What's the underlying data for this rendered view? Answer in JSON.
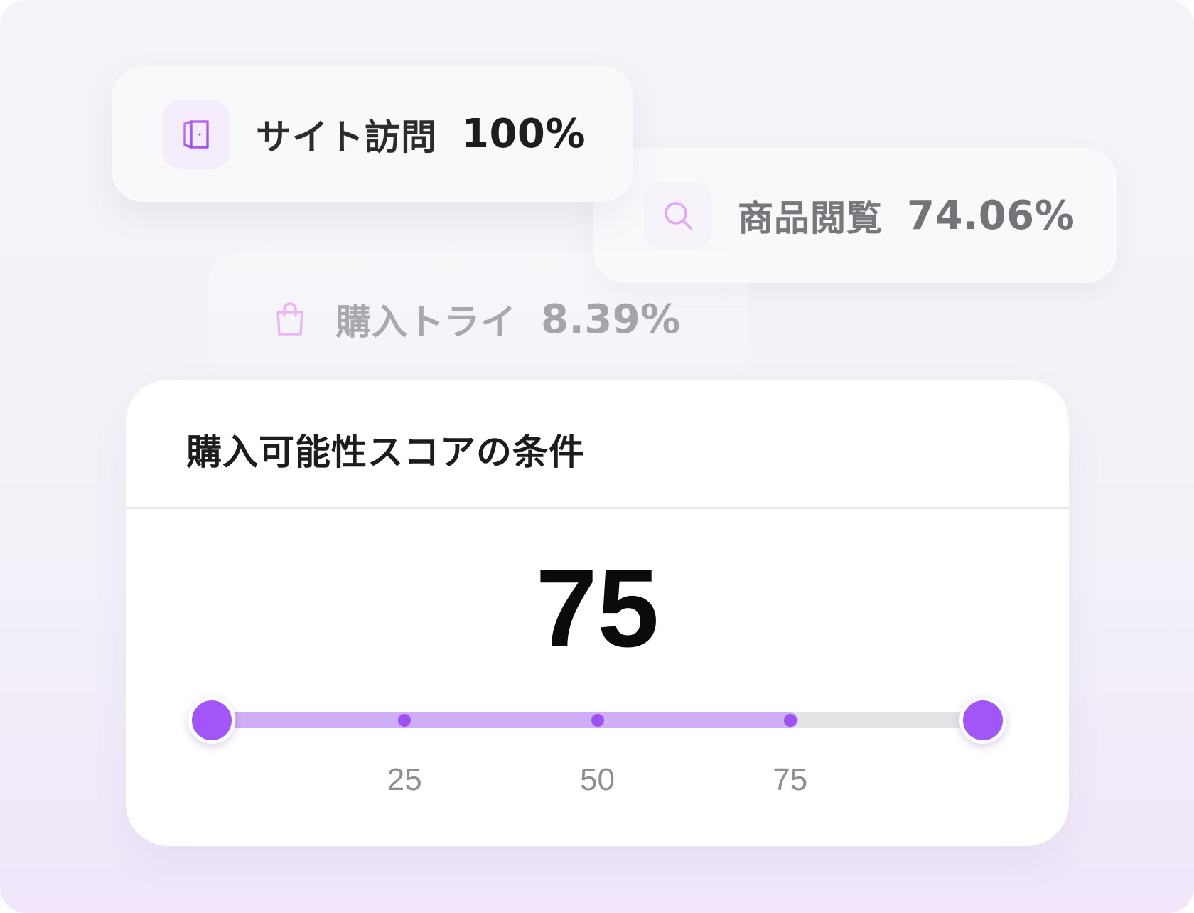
{
  "funnel": [
    {
      "label": "サイト訪問",
      "value": "100%",
      "icon": "door-icon"
    },
    {
      "label": "商品閲覧",
      "value": "74.06%",
      "icon": "search-icon"
    },
    {
      "label": "購入トライ",
      "value": "8.39%",
      "icon": "shopping-bag-icon"
    }
  ],
  "score_card": {
    "title": "購入可能性スコアの条件",
    "score": "75",
    "slider": {
      "min": 0,
      "max": 100,
      "value": 75,
      "ticks": [
        {
          "value": 25,
          "label": "25"
        },
        {
          "value": 50,
          "label": "50"
        },
        {
          "value": 75,
          "label": "75"
        }
      ]
    }
  },
  "colors": {
    "accent": "#a356f7",
    "accent_light": "#d1adf7",
    "track": "#e4e4e6",
    "icon_tint": "#c07ef5"
  }
}
